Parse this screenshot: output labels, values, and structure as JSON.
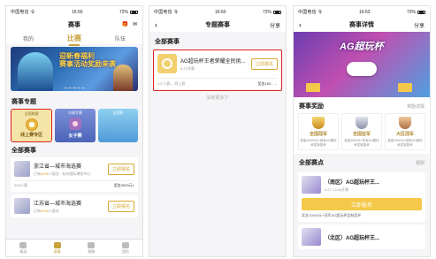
{
  "phone1": {
    "status": {
      "carrier": "中国电信 令",
      "time": "16:50",
      "battery": "72%"
    },
    "header": {
      "title": "赛事"
    },
    "tabs": [
      "我的",
      "比赛",
      "队伍"
    ],
    "banner": {
      "text_line1": "迎新春福利",
      "text_line2": "赛事活动奖励来袭"
    },
    "topics_title": "赛事专题",
    "topics": [
      {
        "tag": "全国联赛",
        "label": "线上赛专区"
      },
      {
        "tag": "巾帼专赛",
        "label": "女子赛"
      },
      {
        "tag": "全国赛",
        "label": ""
      }
    ],
    "float_button": "去赛事圈",
    "all_events_title": "全部赛事",
    "cards": [
      {
        "name": "浙江省—城市海选赛",
        "sub_prefix": "已有",
        "sub_count": "4226",
        "sub_suffix": "人报名 · 杭州国际博览中心",
        "button": "立即报名",
        "foot_left": "5V5人赛",
        "foot_right": "奖金3000元+"
      },
      {
        "name": "江苏省—城市海选赛",
        "sub_prefix": "已有",
        "sub_count": "4226",
        "sub_suffix": "人报名",
        "button": "立即报名"
      }
    ],
    "tabbar": [
      "精选",
      "赛事",
      "赛圈",
      "我的"
    ]
  },
  "phone2": {
    "status": {
      "carrier": "中国电信 令",
      "time": "16:50",
      "battery": "72%"
    },
    "header": {
      "title": "专题赛事",
      "share": "分享"
    },
    "list_title": "全部赛事",
    "card": {
      "name": "AG超玩杯王者荣耀全民挑...",
      "sub": "6-27开赛",
      "button": "立即报名",
      "foot_left": "4人人赛，  线上赛",
      "foot_right": "奖金150..."
    },
    "no_more": "没有更多了"
  },
  "phone3": {
    "status": {
      "carrier": "中国电信 令",
      "time": "16:53",
      "battery": "72%"
    },
    "header": {
      "title": "赛事详情",
      "share": "分享"
    },
    "banner_logo": "AG超玩杯",
    "awards_title": "赛事奖励",
    "awards_more": "奖励详情",
    "awards": [
      {
        "level": "全国冠军",
        "desc": "奖金10000元+冠军AG超玩杯定制奖杯"
      },
      {
        "level": "全国亚军",
        "desc": "奖金5000元+亚军AG超玩杯定制奖杯"
      },
      {
        "level": "大区冠军",
        "desc": "奖金1000元+冠军AG超玩杯定制奖杯"
      }
    ],
    "points_title": "全部赛点",
    "points_more": "规则",
    "matches": [
      {
        "name": "（南区）AG超玩杯王...",
        "date": "6-27 13:00开赛",
        "button": "立即报名",
        "prize": "奖金10000元+冠军AG超玩杯定制奖杯"
      },
      {
        "name": "（北区）AG超玩杯王...",
        "date": ""
      }
    ]
  }
}
